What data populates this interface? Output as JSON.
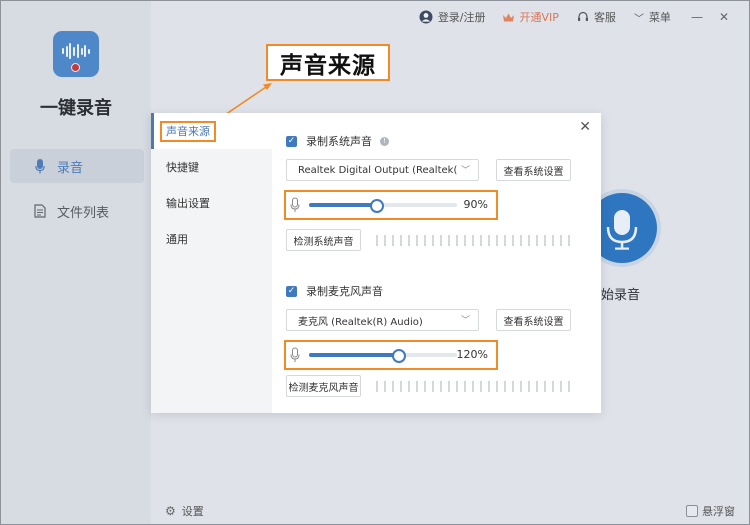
{
  "app": {
    "name": "一键录音",
    "nav": [
      {
        "label": "录音",
        "icon": "microphone-icon",
        "active": true
      },
      {
        "label": "文件列表",
        "icon": "document-icon",
        "active": false
      }
    ],
    "settings_label": "设置",
    "floating_label": "悬浮窗"
  },
  "header": {
    "login": "登录/注册",
    "vip": "开通VIP",
    "support": "客服",
    "menu": "菜单"
  },
  "main": {
    "record_label": "开始录音",
    "record_label_visible": "始录音"
  },
  "annotation": {
    "label": "声音来源"
  },
  "dialog": {
    "tabs": [
      "声音来源",
      "快捷键",
      "输出设置",
      "通用"
    ],
    "active_tab": 0,
    "system": {
      "checkbox_label": "录制系统声音",
      "checked": true,
      "device": "Realtek Digital Output (Realtek(R) Au",
      "settings_button": "查看系统设置",
      "volume_percent": 90,
      "volume_label": "90%",
      "detect_button": "检测系统声音"
    },
    "mic": {
      "checkbox_label": "录制麦克风声音",
      "checked": true,
      "device": "麦克风 (Realtek(R) Audio)",
      "settings_button": "查看系统设置",
      "volume_percent": 120,
      "volume_label": "120%",
      "detect_button": "检测麦克风声音"
    }
  },
  "colors": {
    "accent": "#3f7ac0",
    "annotation": "#f18b27",
    "vip": "#d9765a"
  }
}
